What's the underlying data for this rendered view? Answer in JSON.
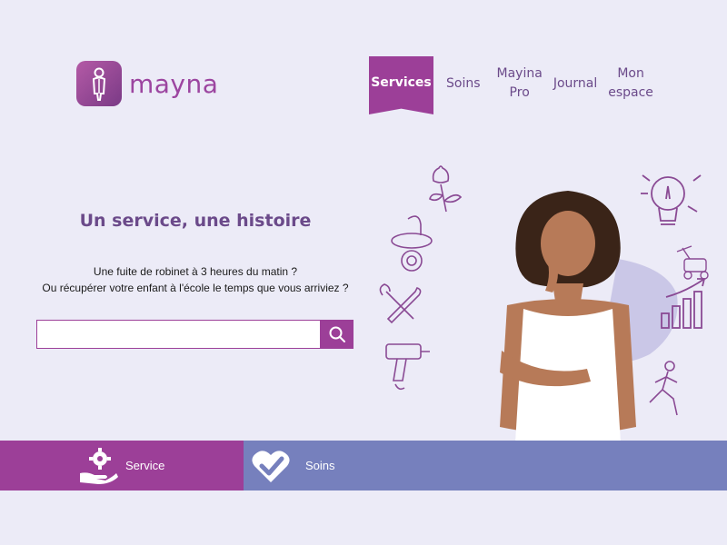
{
  "brand": {
    "name": "mayna"
  },
  "nav": {
    "services": "Services",
    "soins": "Soins",
    "mayina_pro_line1": "Mayina",
    "mayina_pro_line2": "Pro",
    "journal": "Journal",
    "mon_espace_line1": "Mon",
    "mon_espace_line2": "espace"
  },
  "hero": {
    "headline": "Un service, une histoire",
    "line1": "Une fuite de robinet à 3 heures du matin ?",
    "line2": "Ou récupérer votre enfant à l'école le temps que vous arriviez ?"
  },
  "search": {
    "value": "",
    "placeholder": ""
  },
  "footer": {
    "service_label": "Service",
    "soins_label": "Soins"
  },
  "colors": {
    "accent": "#9c3f98",
    "secondary": "#7680bd",
    "background": "#ecebf7"
  },
  "icons": [
    "flower-icon",
    "pacifier-icon",
    "tools-icon",
    "drill-icon",
    "lightbulb-icon",
    "lawnmower-icon",
    "chart-growth-icon",
    "runner-icon",
    "search-icon",
    "hand-gear-icon",
    "heart-check-icon"
  ]
}
